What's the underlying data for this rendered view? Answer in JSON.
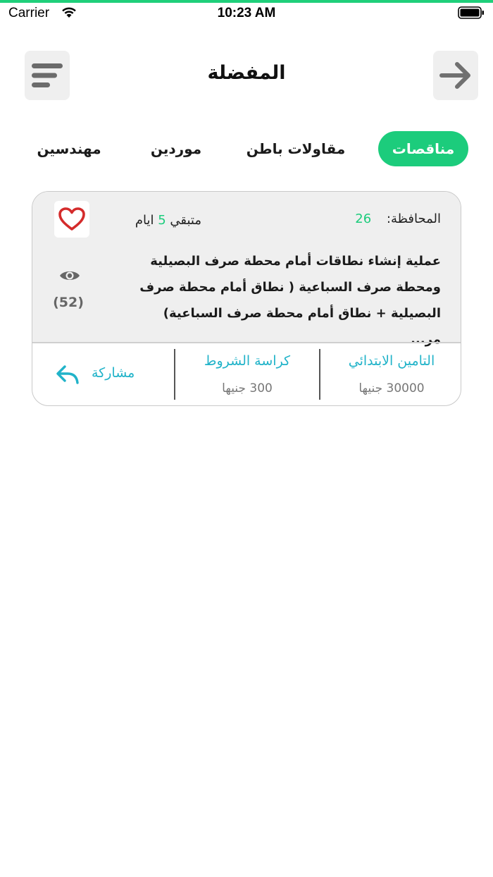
{
  "status_bar": {
    "carrier": "Carrier",
    "time": "10:23 AM"
  },
  "header": {
    "title": "المفضلة"
  },
  "tabs": [
    {
      "label": "مناقصات",
      "active": true
    },
    {
      "label": "مقاولات باطن",
      "active": false
    },
    {
      "label": "موردين",
      "active": false
    },
    {
      "label": "مهندسين",
      "active": false
    }
  ],
  "card": {
    "province_label": "المحافظة:",
    "province_value": "26",
    "remaining_prefix": "متبقي",
    "remaining_days": "5",
    "remaining_suffix": "ايام",
    "title": "عملية إنشاء نطاقات أمام محطة صرف البصيلية ومحطة صرف السباعية ( نطاق أمام محطة صرف البصيلية + نطاق أمام محطة صرف السباعية) مر...",
    "views": "(52)",
    "insurance_label": "التامين الابتدائي",
    "insurance_value": "30000 جنيها",
    "booklet_label": "كراسة الشروط",
    "booklet_value": "300 جنيها",
    "share_label": "مشاركة"
  },
  "colors": {
    "accent": "#1ccc7c",
    "link": "#21b3c9",
    "heart": "#d42b2b"
  }
}
